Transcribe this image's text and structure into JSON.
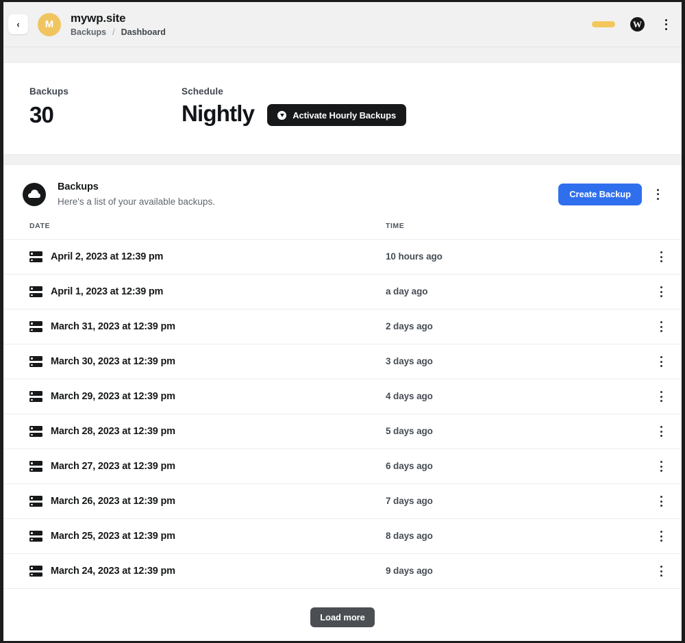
{
  "topbar": {
    "back_icon": "chevron-left-icon",
    "avatar_initial": "M",
    "avatar_color": "#f0c560",
    "site_title": "mywp.site",
    "breadcrumb": {
      "parent": "Backups",
      "separator": "/",
      "current": "Dashboard"
    },
    "status_pill_color": "#f2c75c",
    "wordpress_glyph": "W",
    "overflow_icon": "vertical-dots-icon"
  },
  "stats": {
    "backups_label": "Backups",
    "backups_value": "30",
    "schedule_label": "Schedule",
    "schedule_value": "Nightly",
    "activate_button": "Activate Hourly Backups",
    "activate_icon": "lightning-circle-icon"
  },
  "backups_card": {
    "icon": "cloud-icon",
    "title": "Backups",
    "subtitle": "Here's a list of your available backups.",
    "create_button": "Create Backup",
    "create_button_color": "#2f6fed",
    "overflow_icon": "vertical-dots-icon"
  },
  "table": {
    "columns": [
      "DATE",
      "TIME",
      ""
    ],
    "row_icon": "server-stack-icon",
    "row_menu_icon": "vertical-dots-icon",
    "rows": [
      {
        "date": "April 2, 2023 at 12:39 pm",
        "time": "10 hours ago"
      },
      {
        "date": "April 1, 2023 at 12:39 pm",
        "time": "a day ago"
      },
      {
        "date": "March 31, 2023 at 12:39 pm",
        "time": "2 days ago"
      },
      {
        "date": "March 30, 2023 at 12:39 pm",
        "time": "3 days ago"
      },
      {
        "date": "March 29, 2023 at 12:39 pm",
        "time": "4 days ago"
      },
      {
        "date": "March 28, 2023 at 12:39 pm",
        "time": "5 days ago"
      },
      {
        "date": "March 27, 2023 at 12:39 pm",
        "time": "6 days ago"
      },
      {
        "date": "March 26, 2023 at 12:39 pm",
        "time": "7 days ago"
      },
      {
        "date": "March 25, 2023 at 12:39 pm",
        "time": "8 days ago"
      },
      {
        "date": "March 24, 2023 at 12:39 pm",
        "time": "9 days ago"
      }
    ]
  },
  "footer": {
    "load_more": "Load more",
    "load_more_color": "#4b4f54"
  }
}
